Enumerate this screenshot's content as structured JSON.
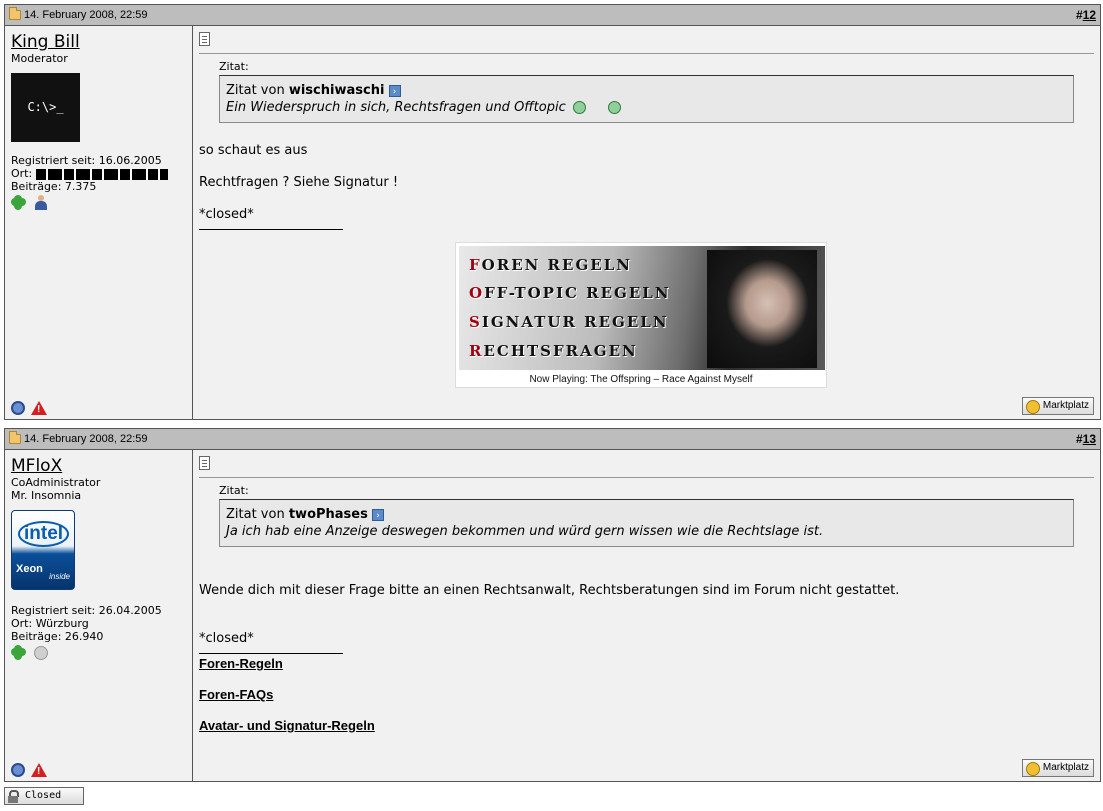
{
  "posts": [
    {
      "date": "14. February 2008, 22:59",
      "number_prefix": "#",
      "number": "12",
      "user": {
        "name": "King Bill",
        "title": "Moderator",
        "subtitle": "",
        "avatar_text": "C:\\>_",
        "registered": "Registriert seit: 16.06.2005",
        "location_label": "Ort:",
        "location": "",
        "posts": "Beiträge: 7.375",
        "badges": [
          "clover-icon",
          "person-icon"
        ]
      },
      "quote": {
        "label": "Zitat:",
        "from_prefix": "Zitat von",
        "author": "wischiwaschi",
        "text": "Ein Wiederspruch in sich, Rechtsfragen und Offtopic"
      },
      "paragraphs": [
        "so schaut es aus",
        "Rechtfragen ? Siehe Signatur !",
        "*closed*"
      ],
      "signature": {
        "lines": [
          "FOREN REGELN",
          "OFF-TOPIC REGELN",
          "SIGNATUR REGELN",
          "RECHTSFRAGEN"
        ],
        "caption": "Now Playing: The Offspring – Race Against Myself"
      },
      "market_label": "Marktplatz"
    },
    {
      "date": "14. February 2008, 22:59",
      "number_prefix": "#",
      "number": "13",
      "user": {
        "name": "MFloX",
        "title": "CoAdministrator",
        "subtitle": "Mr. Insomnia",
        "avatar_brand": "intel",
        "avatar_model": "Xeon",
        "avatar_inside": "inside",
        "registered": "Registriert seit: 26.04.2005",
        "location_label": "Ort: Würzburg",
        "posts": "Beiträge: 26.940",
        "badges": [
          "clover-icon",
          "mouse-icon"
        ]
      },
      "quote": {
        "label": "Zitat:",
        "from_prefix": "Zitat von",
        "author": "twoPhases",
        "text": "Ja ich hab eine Anzeige deswegen bekommen und würd gern wissen wie die Rechtslage ist."
      },
      "paragraphs": [
        "Wende dich mit dieser Frage bitte an einen Rechtsanwalt, Rechtsberatungen sind im Forum nicht gestattet.",
        "*closed*"
      ],
      "links": [
        "Foren-Regeln",
        "Foren-FAQs",
        "Avatar- und Signatur-Regeln"
      ],
      "market_label": "Marktplatz"
    }
  ],
  "closed_label": "Closed"
}
